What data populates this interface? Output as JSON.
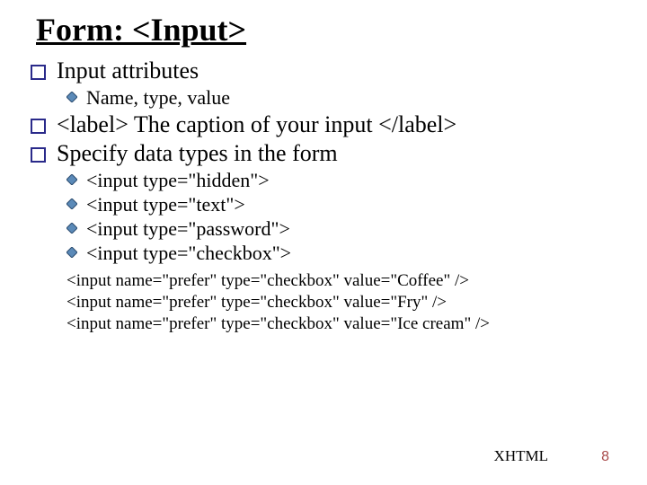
{
  "title": "Form: <Input>",
  "bullets": {
    "b1": "Input attributes",
    "b1_1": "Name, type, value",
    "b2": "<label> The caption of your input </label>",
    "b3": "Specify data types in the form",
    "b3_1": "<input type=\"hidden\">",
    "b3_2": "<input type=\"text\">",
    "b3_3": "<input type=\"password\">",
    "b3_4": "<input type=\"checkbox\">"
  },
  "code": {
    "l1": "<input name=\"prefer\" type=\"checkbox\" value=\"Coffee\"  />",
    "l2": "<input name=\"prefer\" type=\"checkbox\" value=\"Fry\" />",
    "l3": "<input name=\"prefer\" type=\"checkbox\" value=\"Ice cream\" />"
  },
  "footer": {
    "label": "XHTML",
    "page": "8"
  }
}
